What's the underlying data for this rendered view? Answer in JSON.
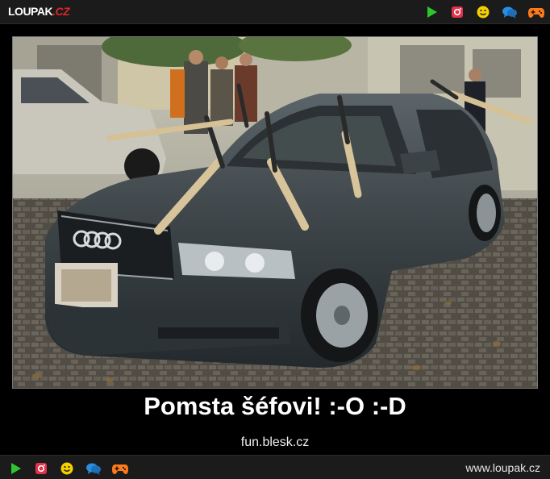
{
  "header": {
    "logo_main": "LOUPAK",
    "logo_tld": ".CZ",
    "icons": [
      "play-icon",
      "instagram-icon",
      "smiley-icon",
      "chat-icon",
      "gamepad-icon"
    ]
  },
  "image": {
    "subject": "car-with-pickaxes-photo"
  },
  "caption": "Pomsta šéfovi! :-O :-D",
  "source": "fun.blesk.cz",
  "footer": {
    "site_url": "www.loupak.cz",
    "icons": [
      "play-icon",
      "instagram-icon",
      "smiley-icon",
      "chat-icon",
      "gamepad-icon"
    ]
  },
  "colors": {
    "background": "#000000",
    "bar": "#1b1b1b",
    "play": "#2ec52e",
    "instagram": "#e0324a",
    "smiley": "#f5d000",
    "chat": "#2b8de0",
    "gamepad": "#ff7a1a",
    "logo_accent": "#e0242a"
  }
}
